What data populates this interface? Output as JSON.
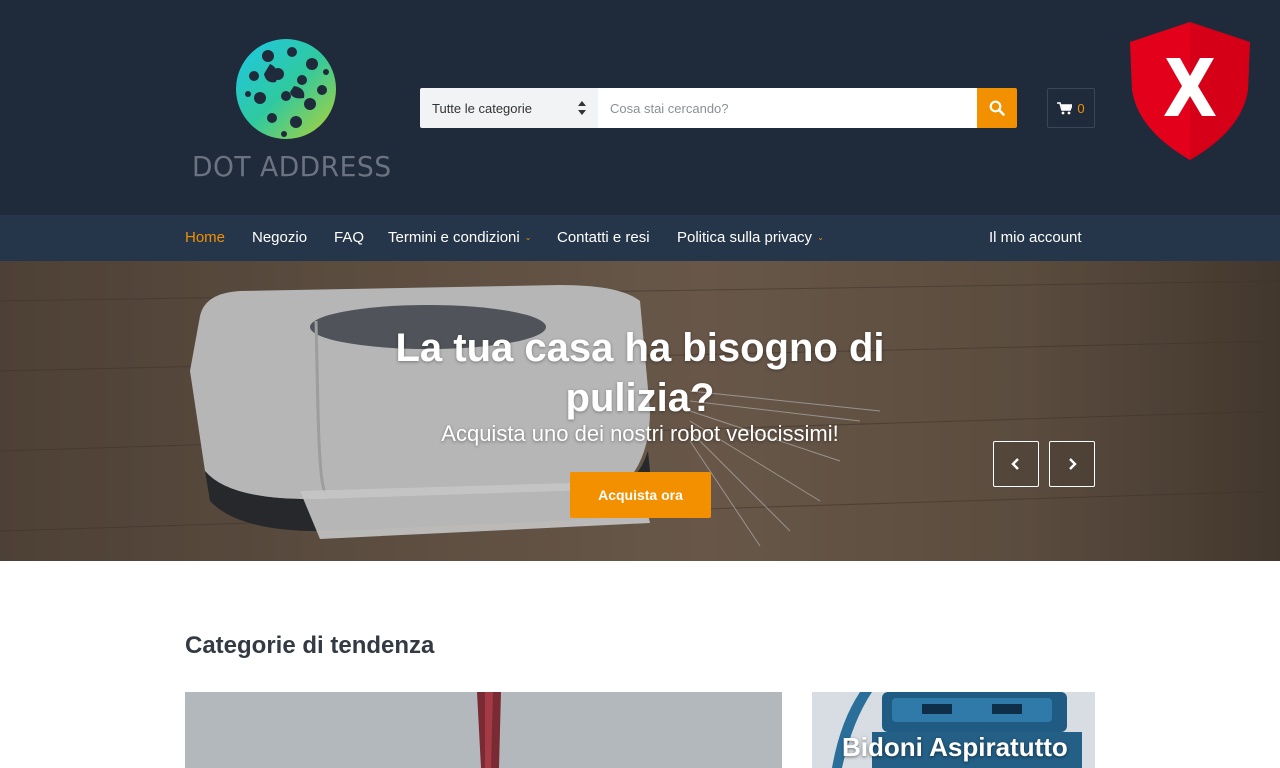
{
  "header": {
    "logo_text": "DOT ADDRESS",
    "search": {
      "category_selected": "Tutte le categorie",
      "placeholder": "Cosa stai cercando?"
    },
    "cart_count": "0"
  },
  "nav": {
    "items": [
      {
        "label": "Home",
        "active": true
      },
      {
        "label": "Negozio"
      },
      {
        "label": "FAQ"
      },
      {
        "label": "Termini e condizioni",
        "has_dropdown": true
      },
      {
        "label": "Contatti e resi"
      },
      {
        "label": "Politica sulla privacy",
        "has_dropdown": true
      }
    ],
    "account_label": "Il mio account"
  },
  "hero": {
    "title": "La tua casa ha bisogno di pulizia?",
    "subtitle": "Acquista uno dei nostri robot velocissimi!",
    "cta_label": "Acquista ora"
  },
  "trending": {
    "title": "Categorie di tendenza",
    "cards": [
      {
        "label": ""
      },
      {
        "label": "Bidoni Aspiratutto"
      }
    ]
  },
  "colors": {
    "header_bg": "#1f2b3a",
    "nav_bg": "#25364a",
    "accent": "#f29000",
    "shield_red": "#e3001b"
  },
  "icons": [
    "logo-mark-icon",
    "sort-arrows-icon",
    "search-icon",
    "cart-icon",
    "shield-x-icon",
    "chevron-left-icon",
    "chevron-right-icon",
    "chevron-down-icon"
  ]
}
